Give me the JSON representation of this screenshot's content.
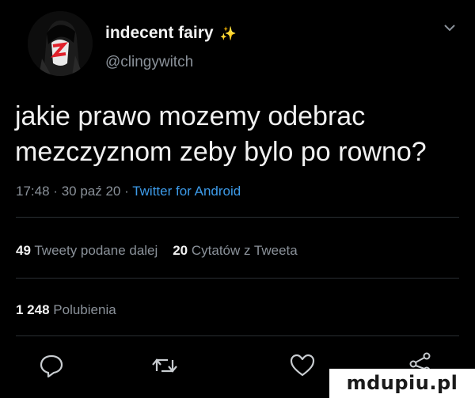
{
  "tweet": {
    "display_name": "indecent fairy",
    "display_name_emoji": "✨",
    "handle": "@clingywitch",
    "text": "jakie prawo mozemy odebrac mezczyznom zeby bylo po rowno?",
    "time": "17:48",
    "date": "30 paź 20",
    "separator": "·",
    "client": "Twitter for Android"
  },
  "stats": {
    "retweets_count": "49",
    "retweets_label": "Tweety podane dalej",
    "quotes_count": "20",
    "quotes_label": "Cytatów z Tweeta",
    "likes_count": "1 248",
    "likes_label": "Polubienia"
  },
  "actions": [
    "reply-icon",
    "retweet-icon",
    "like-icon",
    "share-icon"
  ],
  "watermark": "mdupiu.pl",
  "colors": {
    "background": "#000000",
    "text": "#f1f1f1",
    "secondary": "#8a9199",
    "link": "#3d9be9",
    "divider": "#2a2f33",
    "sparkle": "#ffe14a"
  }
}
